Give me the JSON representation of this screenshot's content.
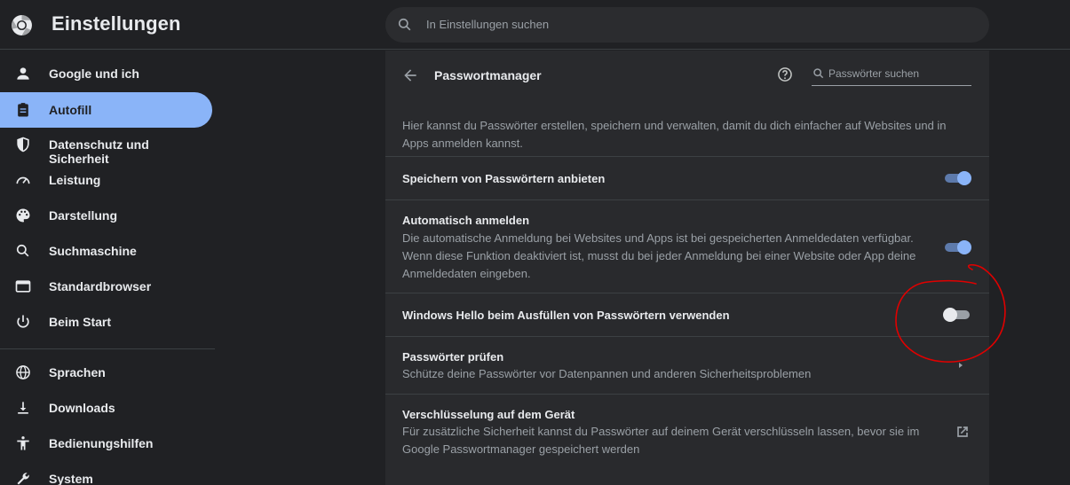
{
  "header": {
    "title": "Einstellungen",
    "logo_icon": "chrome-logo-icon",
    "search_placeholder": "In Einstellungen suchen"
  },
  "sidebar": {
    "items": [
      {
        "label": "Google und ich",
        "icon": "person-icon",
        "active": false
      },
      {
        "label": "Autofill",
        "icon": "clipboard-icon",
        "active": true
      },
      {
        "label": "Datenschutz und Sicherheit",
        "icon": "shield-icon",
        "active": false
      },
      {
        "label": "Leistung",
        "icon": "speedometer-icon",
        "active": false
      },
      {
        "label": "Darstellung",
        "icon": "palette-icon",
        "active": false
      },
      {
        "label": "Suchmaschine",
        "icon": "search-icon",
        "active": false
      },
      {
        "label": "Standardbrowser",
        "icon": "browser-window-icon",
        "active": false
      },
      {
        "label": "Beim Start",
        "icon": "power-icon",
        "active": false
      },
      {
        "label": "Sprachen",
        "icon": "globe-icon",
        "active": false
      },
      {
        "label": "Downloads",
        "icon": "download-icon",
        "active": false
      },
      {
        "label": "Bedienungshilfen",
        "icon": "accessibility-icon",
        "active": false
      },
      {
        "label": "System",
        "icon": "wrench-icon",
        "active": false
      }
    ]
  },
  "panel": {
    "title": "Passwortmanager",
    "search_placeholder": "Passwörter suchen",
    "intro": "Hier kannst du Passwörter erstellen, speichern und verwalten, damit du dich einfacher auf Websites und in Apps anmelden kannst.",
    "rows": [
      {
        "title": "Speichern von Passwörtern anbieten",
        "toggle": true
      },
      {
        "title": "Automatisch anmelden",
        "desc": "Die automatische Anmeldung bei Websites und Apps ist bei gespeicherten Anmeldedaten verfügbar. Wenn diese Funktion deaktiviert ist, musst du bei jeder Anmeldung bei einer Website oder App deine Anmeldedaten eingeben.",
        "toggle": true
      },
      {
        "title": "Windows Hello beim Ausfüllen von Passwörtern verwenden",
        "toggle": false
      },
      {
        "title": "Passwörter prüfen",
        "desc": "Schütze deine Passwörter vor Datenpannen und anderen Sicherheitsproblemen"
      },
      {
        "title": "Verschlüsselung auf dem Gerät",
        "desc": "Für zusätzliche Sicherheit kannst du Passwörter auf deinem Gerät verschlüsseln lassen, bevor sie im Google Passwortmanager gespeichert werden"
      }
    ]
  },
  "colors": {
    "accent": "#8ab4f8",
    "background": "#202124",
    "card": "#292a2d",
    "annotation": "#e00000"
  }
}
